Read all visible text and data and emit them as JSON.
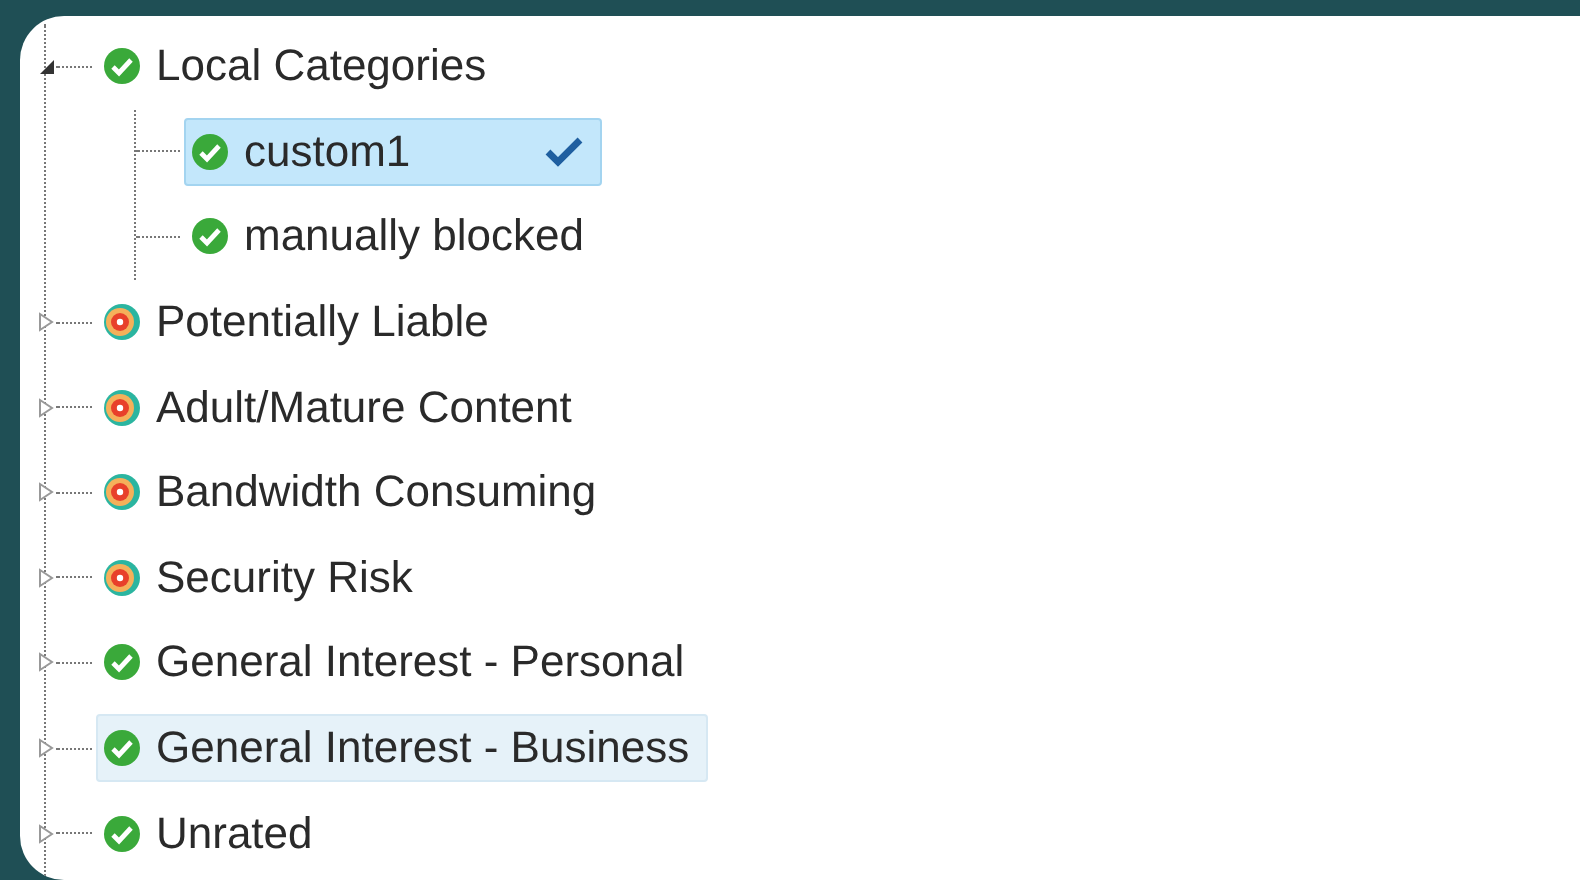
{
  "tree": [
    {
      "label": "Local Categories",
      "kind": "allowed",
      "expanded": true,
      "selected": false,
      "hovered": false,
      "children": [
        {
          "label": "custom1",
          "kind": "allowed",
          "selected": true,
          "hovered": false
        },
        {
          "label": "manually blocked",
          "kind": "allowed",
          "selected": false,
          "hovered": false
        }
      ]
    },
    {
      "label": "Potentially Liable",
      "kind": "mixed",
      "expanded": false,
      "selected": false,
      "hovered": false
    },
    {
      "label": "Adult/Mature Content",
      "kind": "mixed",
      "expanded": false,
      "selected": false,
      "hovered": false
    },
    {
      "label": "Bandwidth Consuming",
      "kind": "mixed",
      "expanded": false,
      "selected": false,
      "hovered": false
    },
    {
      "label": "Security Risk",
      "kind": "mixed",
      "expanded": false,
      "selected": false,
      "hovered": false
    },
    {
      "label": "General Interest - Personal",
      "kind": "allowed",
      "expanded": false,
      "selected": false,
      "hovered": false
    },
    {
      "label": "General Interest - Business",
      "kind": "allowed",
      "expanded": false,
      "selected": false,
      "hovered": true
    },
    {
      "label": "Unrated",
      "kind": "allowed",
      "expanded": false,
      "selected": false,
      "hovered": false
    }
  ]
}
